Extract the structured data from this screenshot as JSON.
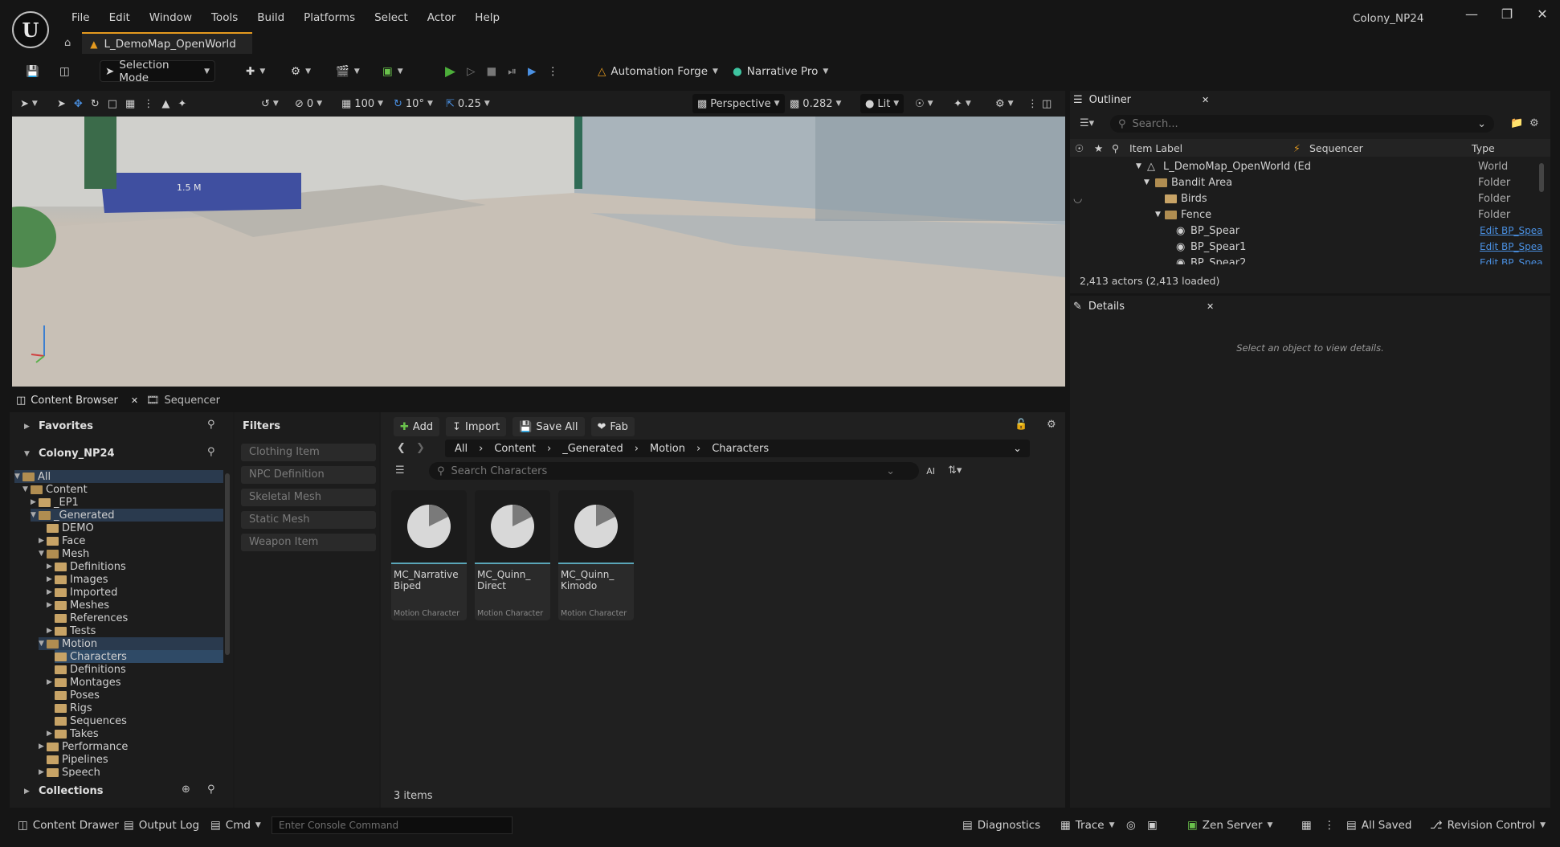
{
  "menu": [
    "File",
    "Edit",
    "Window",
    "Tools",
    "Build",
    "Platforms",
    "Select",
    "Actor",
    "Help"
  ],
  "project_name": "Colony_NP24",
  "map_tab": "L_DemoMap_OpenWorld",
  "toolbar": {
    "mode": "Selection Mode",
    "platform_a": "Automation Forge",
    "platform_b": "Narrative Pro"
  },
  "viewport": {
    "grid_snap": "0",
    "grid_size": "100",
    "rot_snap": "10°",
    "scale_snap": "0.25",
    "view": "Perspective",
    "cam_speed": "0.282",
    "lit": "Lit",
    "sign_text": "1.5 M"
  },
  "content_browser": {
    "tab": "Content Browser",
    "tab2": "Sequencer",
    "favorites": "Favorites",
    "root": "Colony_NP24",
    "collections": "Collections",
    "tree": [
      "All",
      "Content",
      "_EP1",
      "_Generated",
      "DEMO",
      "Face",
      "Mesh",
      "Definitions",
      "Images",
      "Imported",
      "Meshes",
      "References",
      "Tests",
      "Motion",
      "Characters",
      "Definitions",
      "Montages",
      "Poses",
      "Rigs",
      "Sequences",
      "Takes",
      "Performance",
      "Pipelines",
      "Speech"
    ],
    "filters_title": "Filters",
    "filters": [
      "Clothing Item",
      "NPC Definition",
      "Skeletal Mesh",
      "Static Mesh",
      "Weapon Item"
    ],
    "add": "Add",
    "import": "Import",
    "save_all": "Save All",
    "fab": "Fab",
    "path": [
      "All",
      "Content",
      "_Generated",
      "Motion",
      "Characters"
    ],
    "search_placeholder": "Search Characters",
    "ai": "AI",
    "assets": [
      {
        "line1": "MC_Narrative",
        "line2": "Biped",
        "type": "Motion Character"
      },
      {
        "line1": "MC_Quinn_",
        "line2": "Direct",
        "type": "Motion Character"
      },
      {
        "line1": "MC_Quinn_",
        "line2": "Kimodo",
        "type": "Motion Character"
      }
    ],
    "count": "3 items"
  },
  "outliner": {
    "title": "Outliner",
    "search_placeholder": "Search...",
    "col_label": "Item Label",
    "col_seq": "Sequencer",
    "col_type": "Type",
    "rows": [
      {
        "label": "L_DemoMap_OpenWorld (Ed",
        "type": "World"
      },
      {
        "label": "Bandit Area",
        "type": "Folder"
      },
      {
        "label": "Birds",
        "type": "Folder"
      },
      {
        "label": "Fence",
        "type": "Folder"
      },
      {
        "label": "BP_Spear",
        "type": "Edit BP_Spea"
      },
      {
        "label": "BP_Spear1",
        "type": "Edit BP_Spea"
      },
      {
        "label": "BP_Spear2",
        "type": "Edit BP_Spea"
      }
    ],
    "status": "2,413 actors (2,413 loaded)"
  },
  "details": {
    "title": "Details",
    "empty": "Select an object to view details."
  },
  "statusbar": {
    "drawer": "Content Drawer",
    "output": "Output Log",
    "cmd": "Cmd",
    "console_placeholder": "Enter Console Command",
    "diagnostics": "Diagnostics",
    "trace": "Trace",
    "zen": "Zen Server",
    "saved": "All Saved",
    "revision": "Revision Control"
  },
  "colors": {
    "accent_orange": "#e59a1f",
    "play_green": "#4cae3a",
    "link_blue": "#4a90e2",
    "selected": "#2f4a66"
  }
}
